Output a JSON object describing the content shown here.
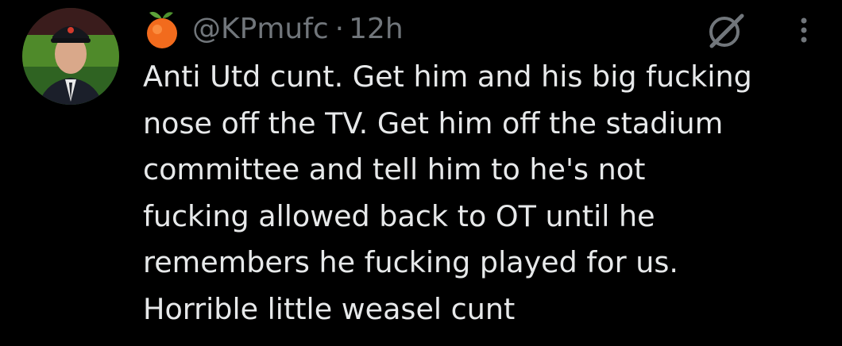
{
  "tweet": {
    "author": {
      "handle": "@KPmufc",
      "emoji": "peach-icon"
    },
    "separator": "·",
    "timestamp": "12h",
    "text_lines": [
      "Anti Utd cunt. Get him and his big fucking",
      "nose off the TV. Get him off the stadium",
      "committee and tell him to he's not",
      "fucking allowed back to OT until he",
      "remembers he fucking played for us.",
      "Horrible little weasel cunt"
    ],
    "actions": {
      "grok": "grok-icon",
      "more": "more-options-icon"
    }
  },
  "colors": {
    "background": "#000000",
    "text": "#e7e9ea",
    "secondary_text": "#71767b"
  }
}
